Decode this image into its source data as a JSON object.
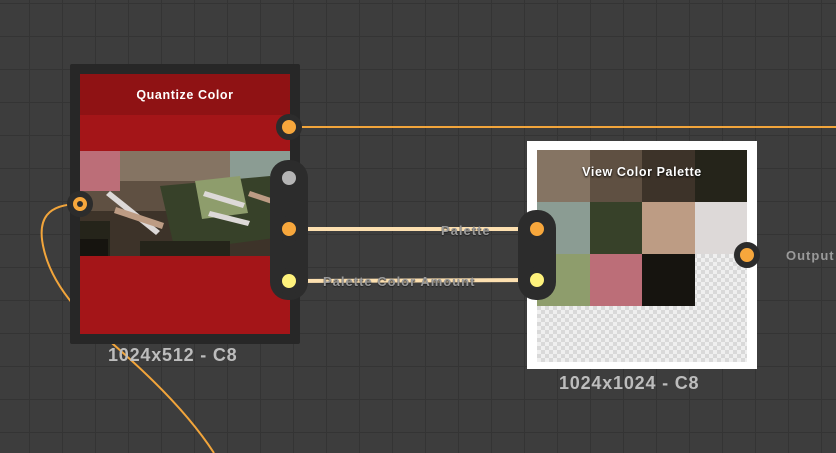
{
  "nodes": {
    "quantize_color": {
      "title": "Quantize Color",
      "size_label": "1024x512 - C8"
    },
    "view_color_palette": {
      "title": "View Color Palette",
      "size_label": "1024x1024 - C8",
      "swatches": [
        "#857463",
        "#5f5042",
        "#3d3329",
        "#25241a",
        "#8b9c93",
        "#374129",
        "#bd9c84",
        "#ddd9d8",
        "#8e9d6c",
        "#bc6e78",
        "#16140f"
      ]
    }
  },
  "wires": {
    "palette_label": "Palette",
    "palette_color_amount_label": "Palette Color Amount",
    "output_label": "Output"
  },
  "colors": {
    "wire_orange": "#f2a53b",
    "wire_cream": "#fde0b0",
    "port_orange": "#f7a73c",
    "port_yellow": "#fef27c",
    "port_gray": "#b5b5b5",
    "node_red": "#a41518",
    "canvas": "#3d3d3d"
  }
}
